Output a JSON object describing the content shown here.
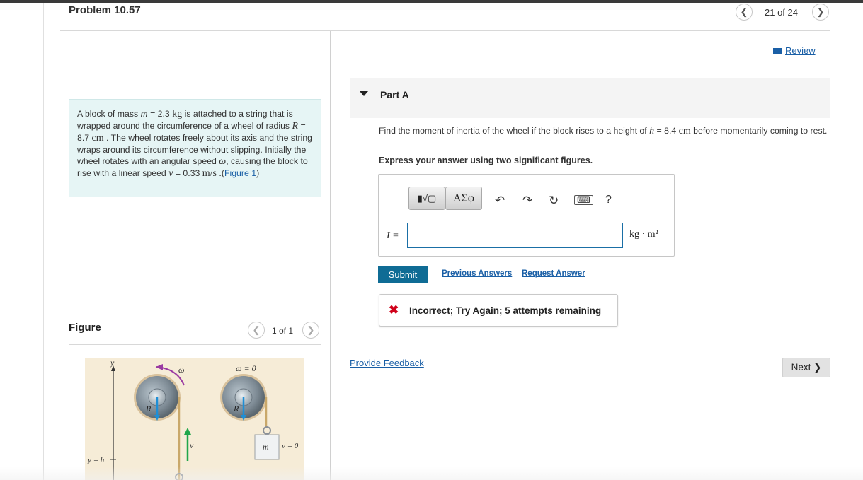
{
  "header": {
    "title": "Problem 10.57",
    "position": "21 of 24"
  },
  "problem": {
    "text_1": "A block of mass ",
    "m_var": "m",
    "text_2": " = 2.3 ",
    "kg": "kg",
    "text_3": " is attached to a string that is wrapped around the circumference of a wheel of radius ",
    "R_var": "R",
    "text_4": " = 8.7 ",
    "cm": "cm",
    "text_5": " . The wheel rotates freely about its axis and the string wraps around its circumference without slipping. Initially the wheel rotates with an angular speed ",
    "omega": "ω",
    "text_6": ", causing the block to rise with a linear speed ",
    "v_var": "v",
    "text_7": " = 0.33 ",
    "ms": "m/s",
    "text_8": " .(",
    "figure_link": "Figure 1",
    "text_9": ")"
  },
  "figure": {
    "label": "Figure",
    "nav": "1 of 1",
    "labels": {
      "y": "y",
      "yh": "y = h",
      "omega": "ω",
      "omega0": "ω = 0",
      "R1": "R",
      "R2": "R",
      "v": "v",
      "m": "m",
      "v0": "v = 0"
    }
  },
  "review": "Review",
  "partA": {
    "title": "Part A",
    "question_1": "Find the moment of inertia of the wheel if the block rises to a height of ",
    "h_var": "h",
    "question_2": " = 8.4 ",
    "cm": "cm",
    "question_3": " before momentarily coming to rest.",
    "express": "Express your answer using two significant figures.",
    "toolbar": {
      "template_label": "▮√▢",
      "greek_label": "ΑΣφ",
      "help_label": "?"
    },
    "input_label": "I =",
    "input_value": "",
    "units": "kg · m²",
    "submit": "Submit",
    "previous_answers": "Previous Answers",
    "request_answer": "Request Answer",
    "feedback": "Incorrect; Try Again; 5 attempts remaining"
  },
  "footer": {
    "provide_feedback": "Provide Feedback",
    "next": "Next ❯"
  },
  "colors": {
    "accent": "#0f6c95",
    "link": "#1a5fa6",
    "error": "#d0021b",
    "problem_bg": "#e6f5f5"
  }
}
